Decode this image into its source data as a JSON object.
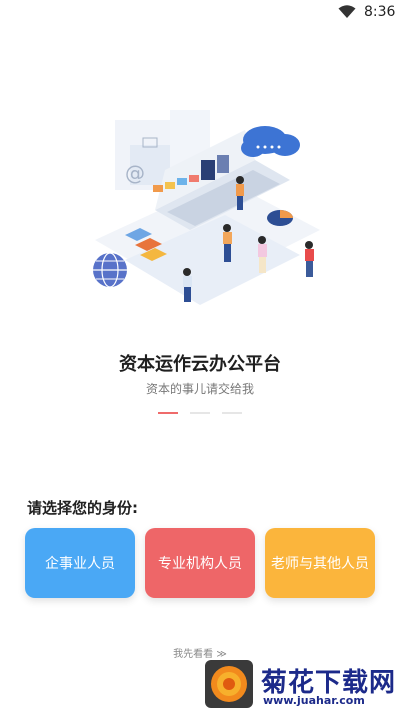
{
  "status_bar": {
    "time": "8:36",
    "wifi_icon": "wifi-icon"
  },
  "app": {
    "title": "资本运作云办公平台",
    "subtitle": "资本的事儿请交给我"
  },
  "pager": {
    "count": 3,
    "active_index": 0,
    "accent": "#ef6b6b"
  },
  "role_prompt": "请选择您的身份:",
  "roles": [
    {
      "label": "企事业人员",
      "color": "#4aa8f5"
    },
    {
      "label": "专业机构人员",
      "color": "#ee6668"
    },
    {
      "label": "老师与其他人员",
      "color": "#fbb53c"
    }
  ],
  "skip_link": "我先看看 ≫",
  "watermark": {
    "name": "菊花下载网",
    "url": "www.juahar.com"
  }
}
